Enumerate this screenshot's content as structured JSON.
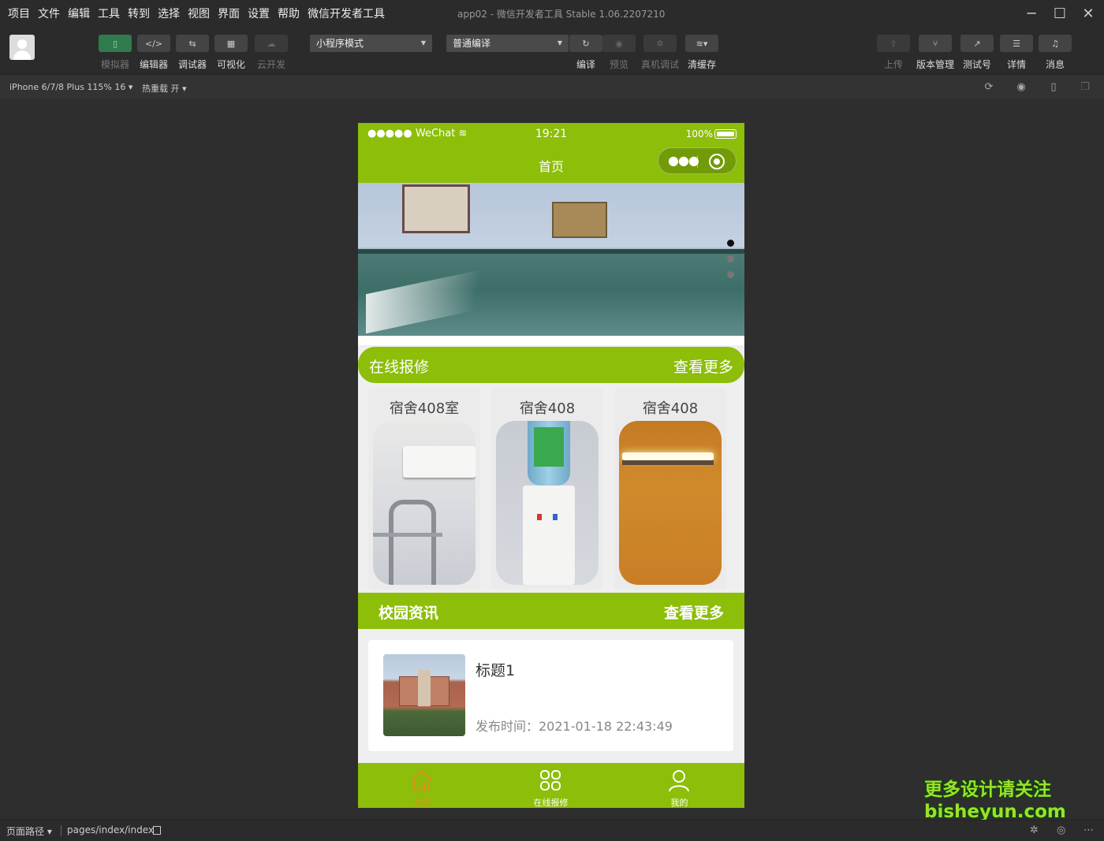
{
  "menubar": {
    "items": [
      "项目",
      "文件",
      "编辑",
      "工具",
      "转到",
      "选择",
      "视图",
      "界面",
      "设置",
      "帮助",
      "微信开发者工具"
    ],
    "window_title": "app02 - 微信开发者工具 Stable 1.06.2207210"
  },
  "toolbar": {
    "simulator": "模拟器",
    "editor": "编辑器",
    "debugger": "调试器",
    "visual": "可视化",
    "cloud": "云开发",
    "mode_select": "小程序模式",
    "compile_select": "普通编译",
    "compile": "编译",
    "preview": "预览",
    "remote_debug": "真机调试",
    "clear_cache": "清缓存",
    "upload": "上传",
    "version": "版本管理",
    "test_account": "测试号",
    "details": "详情",
    "messages": "消息"
  },
  "subbar": {
    "device": "iPhone 6/7/8 Plus 115% 16 ▾",
    "hot_reload": "热重载 开 ▾"
  },
  "phone": {
    "status": {
      "carrier": "●●●●● WeChat",
      "time": "19:21",
      "battery": "100%"
    },
    "nav_title": "首页",
    "repair_section": {
      "title": "在线报修",
      "more": "查看更多",
      "cards": [
        {
          "title": "宿舍408室"
        },
        {
          "title": "宿舍408"
        },
        {
          "title": "宿舍408"
        }
      ]
    },
    "news_section": {
      "title": "校园资讯",
      "more": "查看更多",
      "items": [
        {
          "title": "标题1",
          "date": "发布时间：2021-01-18 22:43:49"
        }
      ]
    },
    "tabbar": [
      {
        "label": "首页",
        "active": true
      },
      {
        "label": "在线报修",
        "active": false
      },
      {
        "label": "我的",
        "active": false
      }
    ]
  },
  "footer": {
    "path_label": "页面路径 ▾",
    "path": "pages/index/index"
  },
  "watermark": {
    "line1": "更多设计请关注",
    "line2": "bisheyun.com"
  },
  "colors": {
    "accent_green": "#8cbe0a",
    "active_tab": "#d8941a",
    "ide_bg": "#2e2e2e"
  }
}
